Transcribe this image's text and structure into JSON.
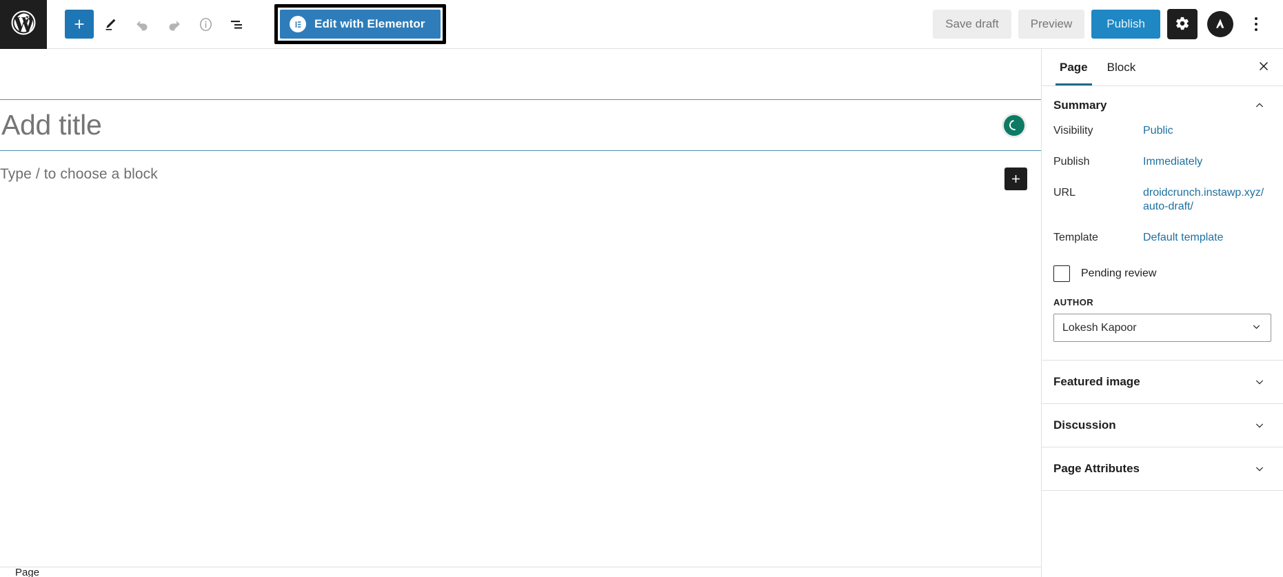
{
  "topbar": {
    "wp_logo_icon": "wordpress-logo-icon",
    "add_block_label": "+",
    "tools": [
      {
        "name": "block-inserter-toggle",
        "icon": "plus-icon"
      },
      {
        "name": "tools-pencil",
        "icon": "pencil-icon"
      },
      {
        "name": "undo",
        "icon": "undo-arrow-icon"
      },
      {
        "name": "redo",
        "icon": "redo-arrow-icon"
      },
      {
        "name": "details",
        "icon": "info-circle-icon"
      },
      {
        "name": "list-view",
        "icon": "list-view-icon"
      }
    ],
    "elementor_button_label": "Edit with Elementor",
    "elementor_badge_icon": "elementor-logo-icon",
    "save_draft_label": "Save draft",
    "preview_label": "Preview",
    "publish_label": "Publish",
    "settings_icon": "gear-icon",
    "avatar_icon": "astra-logo-icon",
    "more_menu_icon": "kebab-vertical-icon",
    "colors": {
      "accent_blue": "#1e76b5",
      "publish_blue": "#1e87c4",
      "elementor_blue": "#2e7dba",
      "dark": "#1e1e1e"
    }
  },
  "editor": {
    "title_placeholder": "Add title",
    "block_placeholder": "Type / to choose a block",
    "spinner_icon": "loading-spinner-icon",
    "inserter_icon": "plus-icon",
    "breadcrumb": "Page"
  },
  "sidebar": {
    "tabs": [
      {
        "label": "Page",
        "active": true
      },
      {
        "label": "Block",
        "active": false
      }
    ],
    "close_icon": "close-icon",
    "summary": {
      "title": "Summary",
      "collapse_icon": "chevron-up-icon",
      "rows": [
        {
          "label": "Visibility",
          "value": "Public"
        },
        {
          "label": "Publish",
          "value": "Immediately"
        },
        {
          "label": "URL",
          "value": "droidcrunch.instawp.xyz/auto-draft/"
        },
        {
          "label": "Template",
          "value": "Default template"
        }
      ],
      "pending_review_label": "Pending review",
      "pending_review_checked": false,
      "author_label": "AUTHOR",
      "author_value": "Lokesh Kapoor",
      "author_chevron_icon": "chevron-down-icon"
    },
    "panels": [
      {
        "title": "Featured image",
        "icon": "chevron-down-icon"
      },
      {
        "title": "Discussion",
        "icon": "chevron-down-icon"
      },
      {
        "title": "Page Attributes",
        "icon": "chevron-down-icon"
      }
    ],
    "link_color": "#1d70a0"
  }
}
